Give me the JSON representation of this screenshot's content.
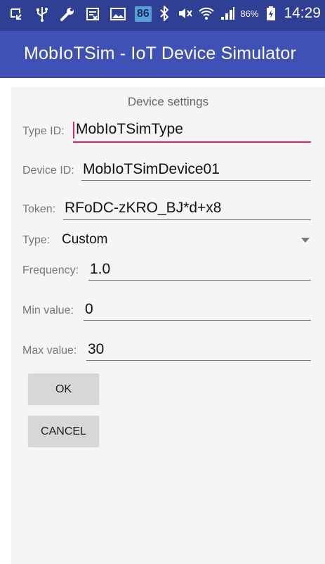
{
  "status_bar": {
    "badge": "86",
    "battery_percent": "86%",
    "time": "14:29",
    "icons_left": [
      "screenshot-icon",
      "usb-icon",
      "wrench-icon",
      "sim-blocked-icon",
      "image-icon"
    ],
    "icons_right": [
      "bluetooth-icon",
      "mute-icon",
      "wifi-icon",
      "signal-icon",
      "battery-charging-icon"
    ]
  },
  "app_bar": {
    "title": "MobIoTSim - IoT Device Simulator"
  },
  "form": {
    "section_title": "Device settings",
    "type_id": {
      "label": "Type ID:",
      "value": "MobIoTSimType"
    },
    "device_id": {
      "label": "Device ID:",
      "value": "MobIoTSimDevice01"
    },
    "token": {
      "label": "Token:",
      "value": "RFoDC-zKRO_BJ*d+x8"
    },
    "type": {
      "label": "Type:",
      "value": "Custom"
    },
    "frequency": {
      "label": "Frequency:",
      "value": "1.0"
    },
    "min_value": {
      "label": "Min value:",
      "value": "0"
    },
    "max_value": {
      "label": "Max value:",
      "value": "30"
    }
  },
  "buttons": {
    "ok": "OK",
    "cancel": "CANCEL"
  },
  "colors": {
    "status_bar": "#2f4094",
    "app_bar": "#3f51b5",
    "accent": "#e91e63",
    "content_bg": "#f5f5f5"
  }
}
